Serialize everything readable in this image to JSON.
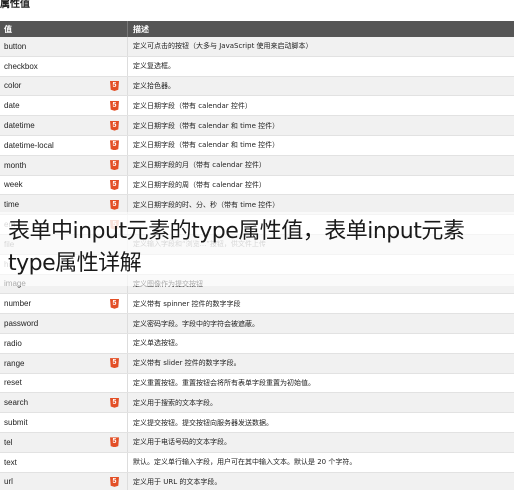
{
  "section_title": "属性值",
  "headline": "表单中input元素的type属性值，表单input元素type属性详解",
  "table": {
    "headers": [
      "值",
      "描述"
    ],
    "rows": [
      {
        "value": "button",
        "desc": "定义可点击的按钮（大多与 JavaScript 使用来启动脚本）",
        "html5": false
      },
      {
        "value": "checkbox",
        "desc": "定义复选框。",
        "html5": false
      },
      {
        "value": "color",
        "desc": "定义拾色器。",
        "html5": true
      },
      {
        "value": "date",
        "desc": "定义日期字段（带有 calendar 控件）",
        "html5": true
      },
      {
        "value": "datetime",
        "desc": "定义日期字段（带有 calendar 和 time 控件）",
        "html5": true
      },
      {
        "value": "datetime-local",
        "desc": "定义日期字段（带有 calendar 和 time 控件）",
        "html5": true
      },
      {
        "value": "month",
        "desc": "定义日期字段的月（带有 calendar 控件）",
        "html5": true
      },
      {
        "value": "week",
        "desc": "定义日期字段的周（带有 calendar 控件）",
        "html5": true
      },
      {
        "value": "time",
        "desc": "定义日期字段的时、分、秒（带有 time 控件）",
        "html5": true
      },
      {
        "value": "em",
        "desc": "",
        "html5": true
      },
      {
        "value": "file",
        "desc": "定义输入字段和“浏览...”按钮，供文件上传",
        "html5": false
      },
      {
        "value": "hi",
        "desc": "",
        "html5": false
      },
      {
        "value": "image",
        "desc": "定义图像作为提交按钮",
        "html5": false
      },
      {
        "value": "number",
        "desc": "定义带有 spinner 控件的数字字段",
        "html5": true
      },
      {
        "value": "password",
        "desc": "定义密码字段。字段中的字符会被遮蔽。",
        "html5": false
      },
      {
        "value": "radio",
        "desc": "定义单选按钮。",
        "html5": false
      },
      {
        "value": "range",
        "desc": "定义带有 slider 控件的数字字段。",
        "html5": true
      },
      {
        "value": "reset",
        "desc": "定义重置按钮。重置按钮会将所有表单字段重置为初始值。",
        "html5": false
      },
      {
        "value": "search",
        "desc": "定义用于搜索的文本字段。",
        "html5": true
      },
      {
        "value": "submit",
        "desc": "定义提交按钮。提交按钮向服务器发送数据。",
        "html5": false
      },
      {
        "value": "tel",
        "desc": "定义用于电话号码的文本字段。",
        "html5": true
      },
      {
        "value": "text",
        "desc": "默认。定义单行输入字段，用户可在其中输入文本。默认是 20 个字符。",
        "html5": false
      },
      {
        "value": "url",
        "desc": "定义用于 URL 的文本字段。",
        "html5": true
      }
    ]
  },
  "html5_badge": "5",
  "colors": {
    "header_bg": "#555555",
    "html5_badge": "#e34f26"
  }
}
